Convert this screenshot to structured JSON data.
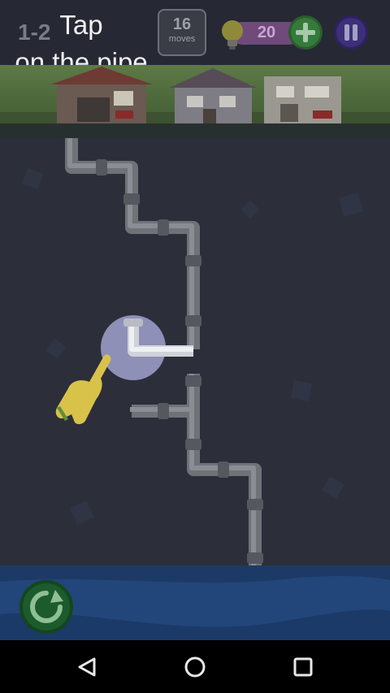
{
  "header": {
    "level": "1-2",
    "hint_line1": "Tap",
    "hint_line2": "on the pipe",
    "moves_count": "16",
    "moves_label": "moves",
    "hints_count": "20"
  },
  "icons": {
    "bulb": "lightbulb-icon",
    "add": "plus-icon",
    "pause": "pause-icon",
    "restart": "restart-icon",
    "pointer": "pointing-hand-icon",
    "back": "back-triangle-icon",
    "home": "home-circle-icon",
    "recents": "recents-square-icon"
  },
  "colors": {
    "background": "#2c2f3a",
    "pipe": "#8a8d93",
    "plus_button": "#347a3a",
    "pause_button": "#3d2f7a",
    "hint_pill": "#6f4a7b",
    "water": "#1d3a66"
  }
}
